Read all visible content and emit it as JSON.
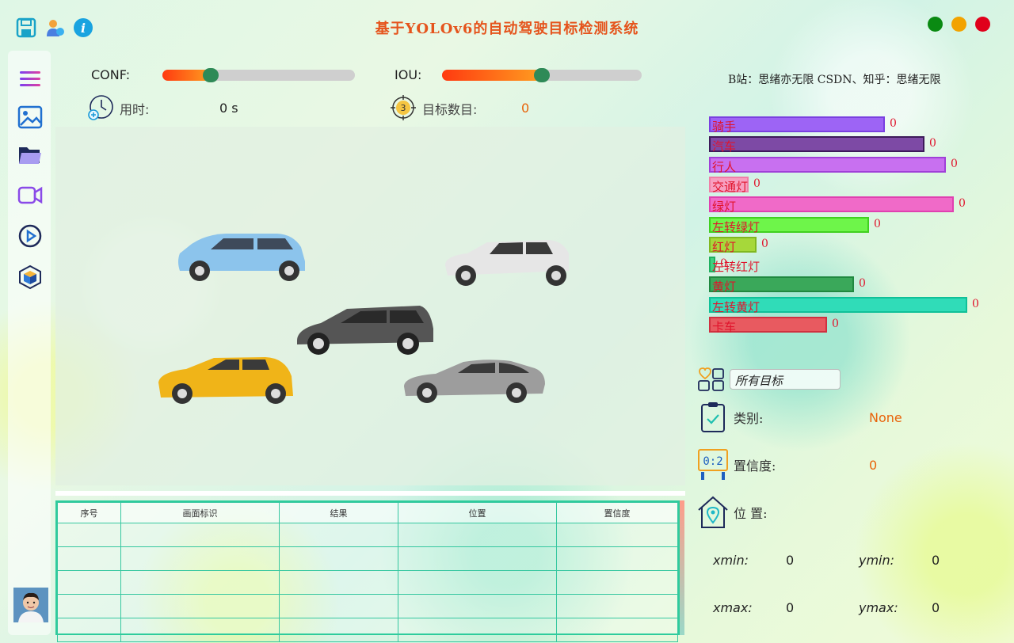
{
  "app": {
    "title": "基于YOLOv6的自动驾驶目标检测系统"
  },
  "colors": {
    "accent": "#e5541c",
    "value": "#e8630a",
    "win_close": "#e0001b",
    "win_minimize": "#f2a300",
    "win_maximize": "#0a8a12",
    "slider_handle": "#2f8a57",
    "table_border": "#36c7a0"
  },
  "toolbar_icons": [
    "save-icon",
    "user-icon",
    "info-icon"
  ],
  "sidebar": {
    "items": [
      {
        "icon": "menu-icon"
      },
      {
        "icon": "image-icon"
      },
      {
        "icon": "folder-icon"
      },
      {
        "icon": "video-camera-icon"
      },
      {
        "icon": "play-icon"
      },
      {
        "icon": "model-cube-icon"
      }
    ],
    "avatar": "avatar"
  },
  "controls": {
    "conf_label": "CONF:",
    "conf_value": 0.25,
    "iou_label": "IOU:",
    "iou_value": 0.5,
    "time_label": "用时:",
    "time_value": "0 s",
    "count_label": "目标数目:",
    "count_value": "0",
    "count_badge": "3"
  },
  "table": {
    "headers": [
      "序号",
      "画面标识",
      "结果",
      "位置",
      "置信度"
    ],
    "rows": [
      [
        "",
        "",
        "",
        "",
        ""
      ],
      [
        "",
        "",
        "",
        "",
        ""
      ],
      [
        "",
        "",
        "",
        "",
        ""
      ],
      [
        "",
        "",
        "",
        "",
        ""
      ],
      [
        "",
        "",
        "",
        "",
        ""
      ]
    ]
  },
  "credit": "B站：思绪亦无限  CSDN、知乎：思绪无限",
  "classes": [
    {
      "name": "骑手",
      "count": "0",
      "color": "#9d64f5",
      "border": "#7a40e0"
    },
    {
      "name": "汽车",
      "count": "0",
      "color": "#7d4aa5",
      "border": "#3d1a5a"
    },
    {
      "name": "行人",
      "count": "0",
      "color": "#c870f0",
      "border": "#a040d8"
    },
    {
      "name": "交通灯",
      "count": "0",
      "color": "#f7a0c0",
      "border": "#f080a8"
    },
    {
      "name": "绿灯",
      "count": "0",
      "color": "#f06ac8",
      "border": "#e040b0"
    },
    {
      "name": "左转绿灯",
      "count": "0",
      "color": "#6ef54a",
      "border": "#40d020"
    },
    {
      "name": "红灯",
      "count": "0",
      "color": "#a6d83a",
      "border": "#80b820"
    },
    {
      "name": "左转红灯",
      "count": "0",
      "color": "#40d080",
      "border": "#20b060"
    },
    {
      "name": "黄灯",
      "count": "0",
      "color": "#3aa85a",
      "border": "#208840"
    },
    {
      "name": "左转黄灯",
      "count": "0",
      "color": "#30dcb8",
      "border": "#10c098"
    },
    {
      "name": "卡车",
      "count": "0",
      "color": "#e85a60",
      "border": "#d03040"
    }
  ],
  "detail": {
    "filter_value": "所有目标",
    "class_label": "类别:",
    "class_value": "None",
    "conf_label": "置信度:",
    "conf_value": "0",
    "position_label": "位 置:",
    "xmin_label": "xmin:",
    "xmin_value": "0",
    "ymin_label": "ymin:",
    "ymin_value": "0",
    "xmax_label": "xmax:",
    "xmax_value": "0",
    "ymax_label": "ymax:",
    "ymax_value": "0"
  }
}
